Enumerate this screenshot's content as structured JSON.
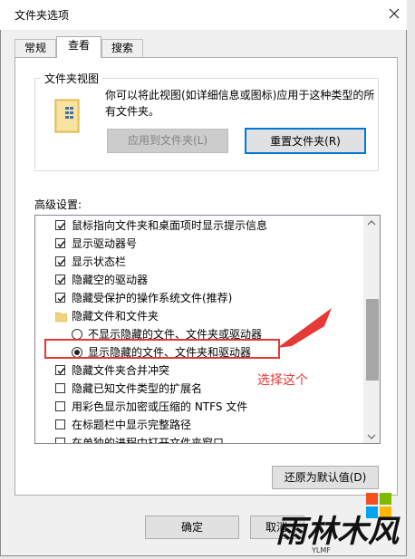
{
  "window": {
    "title": "文件夹选项"
  },
  "tabs": [
    {
      "label": "常规"
    },
    {
      "label": "查看"
    },
    {
      "label": "搜索"
    }
  ],
  "folder_views": {
    "title": "文件夹视图",
    "description": "你可以将此视图(如详细信息或图标)应用于这种类型的所有文件夹。",
    "apply_label": "应用到文件夹(L)",
    "reset_label": "重置文件夹(R)"
  },
  "advanced": {
    "label": "高级设置:",
    "items": [
      {
        "type": "checkbox",
        "checked": true,
        "label": "鼠标指向文件夹和桌面项时显示提示信息"
      },
      {
        "type": "checkbox",
        "checked": true,
        "label": "显示驱动器号"
      },
      {
        "type": "checkbox",
        "checked": true,
        "label": "显示状态栏"
      },
      {
        "type": "checkbox",
        "checked": true,
        "label": "隐藏空的驱动器"
      },
      {
        "type": "checkbox",
        "checked": true,
        "label": "隐藏受保护的操作系统文件(推荐)"
      },
      {
        "type": "folder",
        "label": "隐藏文件和文件夹"
      },
      {
        "type": "radio",
        "checked": false,
        "label": "不显示隐藏的文件、文件夹或驱动器"
      },
      {
        "type": "radio",
        "checked": true,
        "label": "显示隐藏的文件、文件夹和驱动器"
      },
      {
        "type": "checkbox",
        "checked": true,
        "label": "隐藏文件夹合并冲突"
      },
      {
        "type": "checkbox",
        "checked": false,
        "label": "隐藏已知文件类型的扩展名"
      },
      {
        "type": "checkbox",
        "checked": false,
        "label": "用彩色显示加密或压缩的 NTFS 文件"
      },
      {
        "type": "checkbox",
        "checked": false,
        "label": "在标题栏中显示完整路径"
      },
      {
        "type": "checkbox",
        "checked": false,
        "label": "在单独的进程中打开文件夹窗口"
      }
    ]
  },
  "annotation": "选择这个",
  "buttons": {
    "restore": "还原为默认值(D)",
    "ok": "确定",
    "cancel": "取消"
  },
  "watermark": {
    "text": "雨林木风",
    "sub": "YLMF"
  },
  "colors": {
    "accent": "#0078d7",
    "annotation": "#e53935"
  }
}
